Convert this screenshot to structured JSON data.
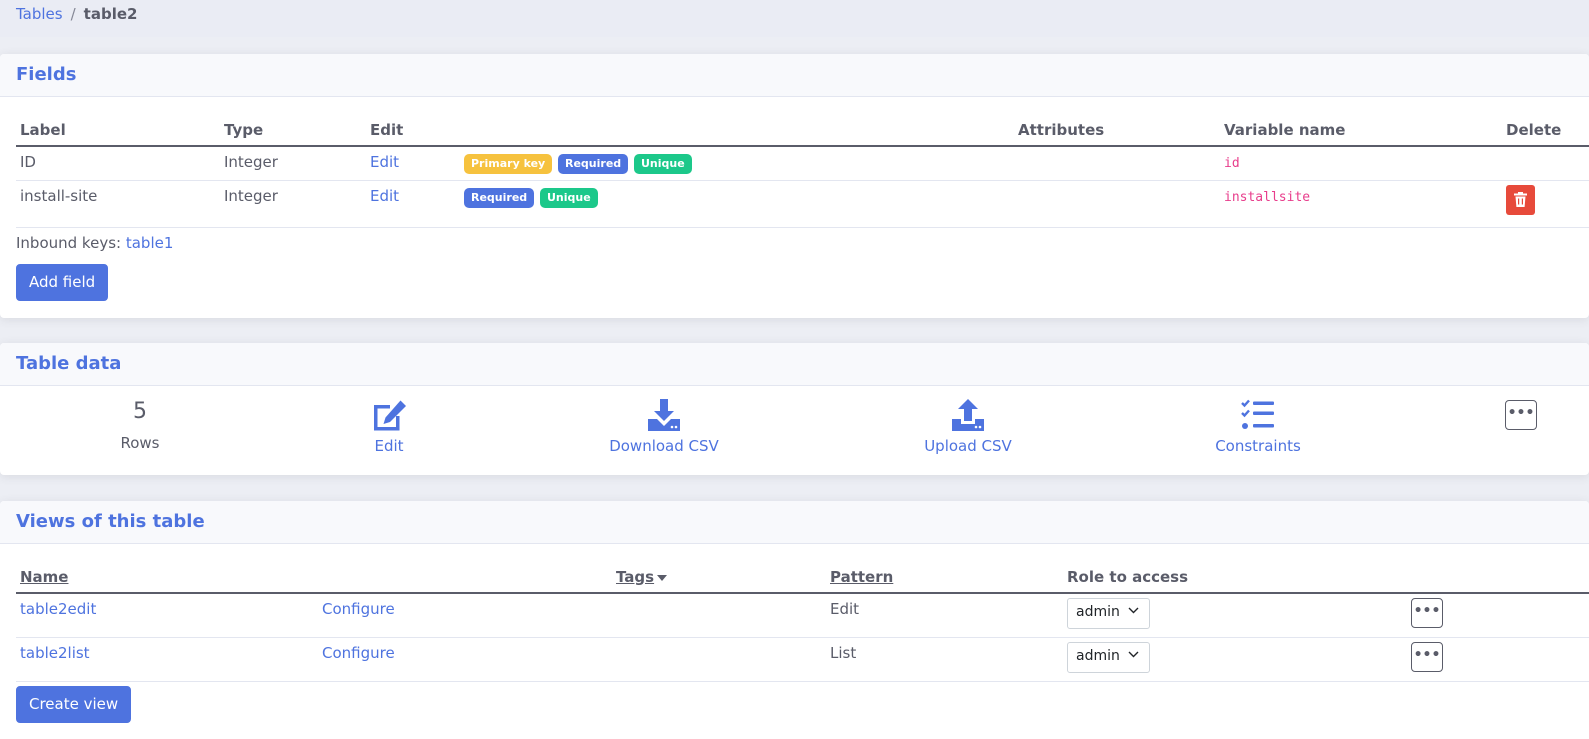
{
  "breadcrumb": {
    "root": "Tables",
    "separator": "/",
    "current": "table2"
  },
  "fields_card": {
    "title": "Fields",
    "columns": [
      "Label",
      "Type",
      "Edit",
      "Attributes",
      "Variable name",
      "Delete"
    ],
    "rows": [
      {
        "label": "ID",
        "type": "Integer",
        "edit": "Edit",
        "badges": [
          "Primary key",
          "Required",
          "Unique"
        ],
        "variable": "id",
        "deletable": false
      },
      {
        "label": "install-site",
        "type": "Integer",
        "edit": "Edit",
        "badges": [
          "Required",
          "Unique"
        ],
        "variable": "installsite",
        "deletable": true
      }
    ],
    "inbound_label": "Inbound keys:",
    "inbound_link": "table1",
    "add_button": "Add field"
  },
  "data_card": {
    "title": "Table data",
    "rows_count": "5",
    "rows_label": "Rows",
    "edit_label": "Edit",
    "download_label": "Download CSV",
    "upload_label": "Upload CSV",
    "constraints_label": "Constraints",
    "more_label": "•••"
  },
  "views_card": {
    "title": "Views of this table",
    "columns": {
      "name": "Name",
      "tags": "Tags",
      "pattern": "Pattern",
      "role": "Role to access"
    },
    "rows": [
      {
        "name": "table2edit",
        "configure": "Configure",
        "pattern": "Edit",
        "role": "admin",
        "more": "•••"
      },
      {
        "name": "table2list",
        "configure": "Configure",
        "pattern": "List",
        "role": "admin",
        "more": "•••"
      }
    ],
    "create_button": "Create view"
  },
  "colors": {
    "primary": "#4e73df",
    "danger": "#e74a3b",
    "warning": "#f6c23e",
    "success": "#1cc88a",
    "code": "#e83e8c",
    "text": "#5a5c69"
  },
  "icons": [
    "trash-icon",
    "edit-icon",
    "download-icon",
    "upload-icon",
    "list-check-icon",
    "ellipsis-icon",
    "chevron-down-icon",
    "sort-caret-icon"
  ]
}
